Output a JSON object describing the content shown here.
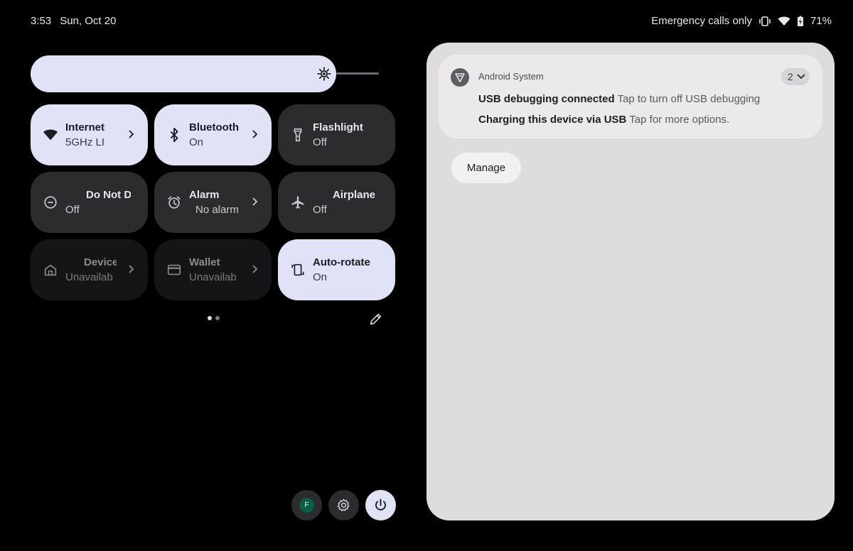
{
  "status_bar": {
    "time": "3:53",
    "date": "Sun, Oct 20",
    "carrier_text": "Emergency calls only",
    "battery": "71%",
    "icons": [
      "vibrate-icon",
      "wifi-icon",
      "battery-charging-icon"
    ]
  },
  "brightness": {
    "level": 0.9,
    "icon": "brightness-icon"
  },
  "tiles": [
    {
      "label": "Internet",
      "sub": "5GHz     LI",
      "state": "on",
      "icon": "wifi-icon"
    },
    {
      "label": "Bluetooth",
      "sub": "On",
      "state": "on",
      "icon": "bluetooth-icon"
    },
    {
      "label": "Flashlight",
      "sub": "Off",
      "state": "off",
      "icon": "flashlight-icon"
    },
    {
      "label": "Do Not D",
      "sub": "Off",
      "state": "off",
      "icon": "do-not-disturb-icon"
    },
    {
      "label": "Alarm",
      "sub": "No alarm",
      "state": "off",
      "icon": "alarm-icon"
    },
    {
      "label": "Airplane",
      "sub": "Off",
      "state": "off",
      "icon": "airplane-icon"
    },
    {
      "label": "Device",
      "sub": "Unavailab",
      "state": "unavailable",
      "icon": "home-icon"
    },
    {
      "label": "Wallet",
      "sub": "Unavailab",
      "state": "unavailable",
      "icon": "wallet-icon"
    },
    {
      "label": "Auto-rotate",
      "sub": "On",
      "state": "on",
      "icon": "auto-rotate-icon"
    }
  ],
  "pager": {
    "pages": 2,
    "current": 1
  },
  "quick_actions": {
    "avatar_initial": "F"
  },
  "notification": {
    "app_name": "Android System",
    "count": "2",
    "items": [
      {
        "title": "USB debugging connected",
        "text": "Tap to turn off USB debugging"
      },
      {
        "title": "Charging this device via USB",
        "text": "Tap for more options."
      }
    ]
  },
  "manage_label": "Manage",
  "colors": {
    "tile_on": "#dfe3f5",
    "tile_off": "#2c2c2f",
    "panel": "#dedcdd"
  }
}
